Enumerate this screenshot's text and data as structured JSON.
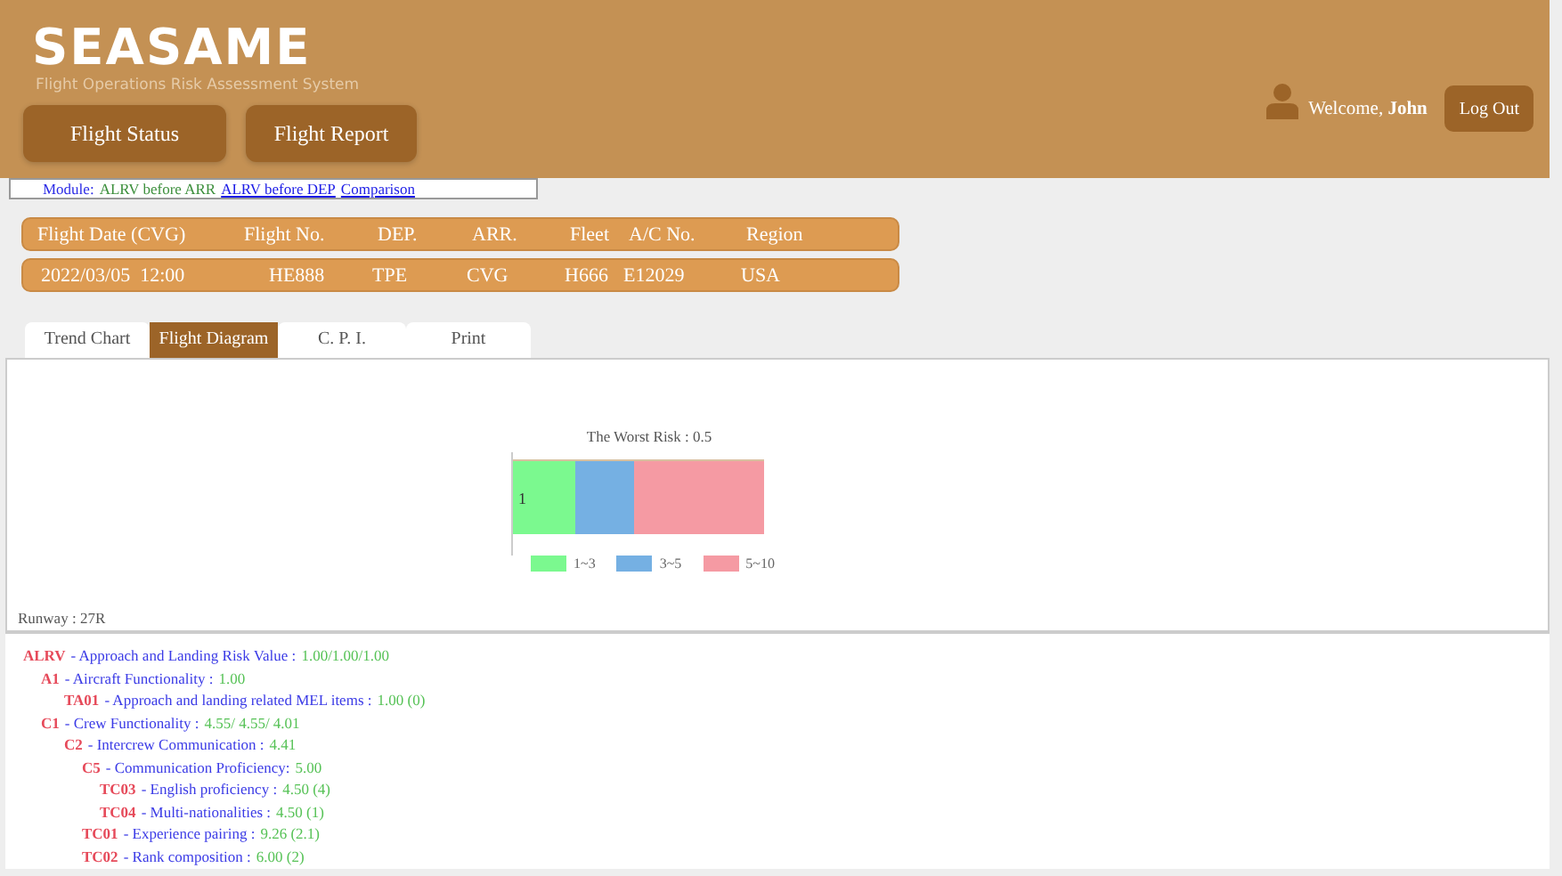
{
  "header": {
    "logo": "SEASAME",
    "subtitle": "Flight Operations Risk Assessment System",
    "nav": [
      {
        "label": "Flight Status"
      },
      {
        "label": "Flight Report"
      }
    ],
    "welcome_prefix": "Welcome,",
    "user": "John",
    "logout": "Log Out"
  },
  "module_bar": {
    "label": "Module:",
    "current": "ALRV before ARR",
    "links": [
      "ALRV before DEP",
      "Comparison"
    ]
  },
  "flight_info": {
    "columns": [
      "Flight Date (CVG)",
      "Flight No.",
      "DEP.",
      "ARR.",
      "Fleet",
      "A/C No.",
      "Region"
    ],
    "values": [
      "2022/03/05  12:00",
      "HE888",
      "TPE",
      "CVG",
      "H666",
      "E12029",
      "USA"
    ]
  },
  "tabs": [
    {
      "label": "Trend Chart",
      "selected": false
    },
    {
      "label": "Flight Diagram",
      "selected": true
    },
    {
      "label": "C. P. I.",
      "selected": false
    },
    {
      "label": "Print",
      "selected": false
    }
  ],
  "diagram": {
    "title": "The Worst Risk : 0.5",
    "bar_label": "1",
    "legend": [
      {
        "label": "1~3",
        "color": "#7bf98f"
      },
      {
        "label": "3~5",
        "color": "#75b0e3"
      },
      {
        "label": "5~10",
        "color": "#f59aa3"
      }
    ],
    "runway": "Runway : 27R"
  },
  "risk_tree": [
    {
      "code": "ALRV",
      "label": "- Approach and Landing Risk Value :",
      "value": "1.00/1.00/1.00",
      "children": [
        {
          "code": "A1",
          "label": "- Aircraft Functionality :",
          "value": "1.00",
          "children": [
            {
              "code": "TA01",
              "label": "- Approach and landing related MEL items :",
              "value": "1.00 (0)"
            }
          ]
        },
        {
          "code": "C1",
          "label": "- Crew Functionality :",
          "value": "4.55/ 4.55/ 4.01",
          "children": [
            {
              "code": "C2",
              "label": "- Intercrew Communication :",
              "value": "4.41",
              "children": [
                {
                  "code": "C5",
                  "label": "- Communication Proficiency:",
                  "value": "5.00",
                  "children": [
                    {
                      "code": "TC03",
                      "label": "- English proficiency :",
                      "value": "4.50 (4)"
                    },
                    {
                      "code": "TC04",
                      "label": "- Multi-nationalities :",
                      "value": "4.50 (1)"
                    }
                  ]
                },
                {
                  "code": "TC01",
                  "label": "- Experience pairing :",
                  "value": "9.26 (2.1)"
                },
                {
                  "code": "TC02",
                  "label": "- Rank composition :",
                  "value": "6.00 (2)"
                }
              ]
            }
          ]
        }
      ]
    }
  ]
}
